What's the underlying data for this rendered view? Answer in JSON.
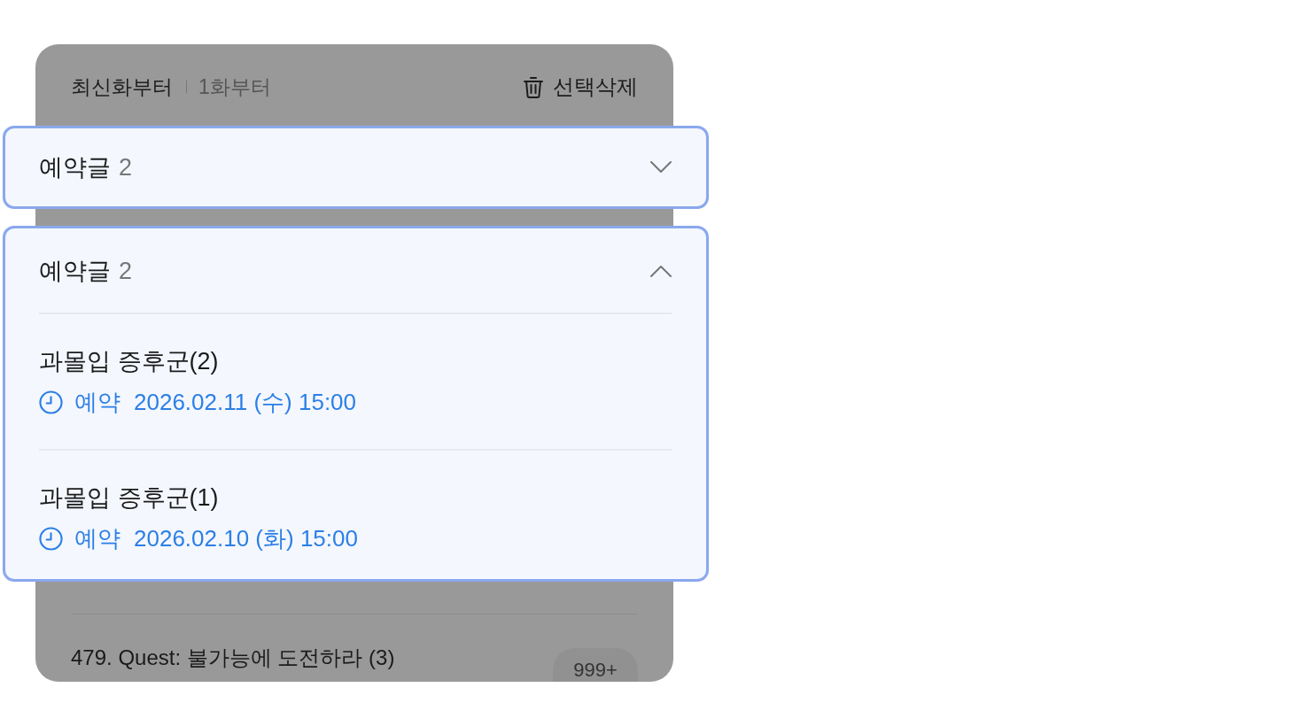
{
  "list_panel": {
    "sort_options": [
      {
        "label": "최신화부터",
        "selected": true
      },
      {
        "label": "1화부터",
        "selected": false
      }
    ],
    "delete_button": {
      "label": "선택삭제"
    },
    "episodes": [
      {
        "title": "479. Quest: 불가능에 도전하라 (3)",
        "badge": "999+"
      }
    ]
  },
  "reserved_sections": [
    {
      "label": "예약글",
      "count": "2",
      "expanded": false
    },
    {
      "label": "예약글",
      "count": "2",
      "expanded": true,
      "items": [
        {
          "title": "과몰입 증후군(2)",
          "status": "예약",
          "datetime": "2026.02.11 (수) 15:00"
        },
        {
          "title": "과몰입 증후군(1)",
          "status": "예약",
          "datetime": "2026.02.10 (화) 15:00"
        }
      ]
    }
  ]
}
